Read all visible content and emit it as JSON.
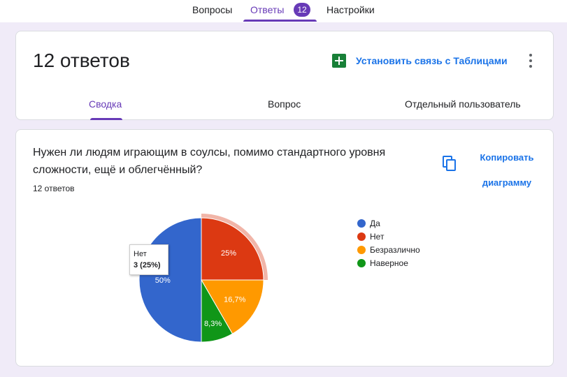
{
  "topnav": {
    "tabs": [
      "Вопросы",
      "Ответы",
      "Настройки"
    ],
    "badge": "12"
  },
  "header": {
    "title": "12 ответов",
    "sheets_link": "Установить связь с Таблицами",
    "subtabs": [
      "Сводка",
      "Вопрос",
      "Отдельный пользователь"
    ]
  },
  "question": {
    "text": "Нужен ли людям играющим в соулсы,  помимо стандартного уровня сложности, ещё и облегчённый?",
    "count": "12 ответов",
    "copy_label_line1": "Копировать",
    "copy_label_line2": "диаграмму"
  },
  "chart_data": {
    "type": "pie",
    "slices": [
      {
        "label": "Да",
        "value": 6,
        "percent_label": "50%",
        "color": "#3366cc"
      },
      {
        "label": "Нет",
        "value": 3,
        "percent_label": "25%",
        "color": "#dc3912"
      },
      {
        "label": "Безразлично",
        "value": 2,
        "percent_label": "16,7%",
        "color": "#ff9900"
      },
      {
        "label": "Наверное",
        "value": 1,
        "percent_label": "8,3%",
        "color": "#109618"
      }
    ],
    "legend_position": "right",
    "highlighted": "Нет"
  },
  "tooltip": {
    "label": "Нет",
    "value": "3 (25%)"
  }
}
